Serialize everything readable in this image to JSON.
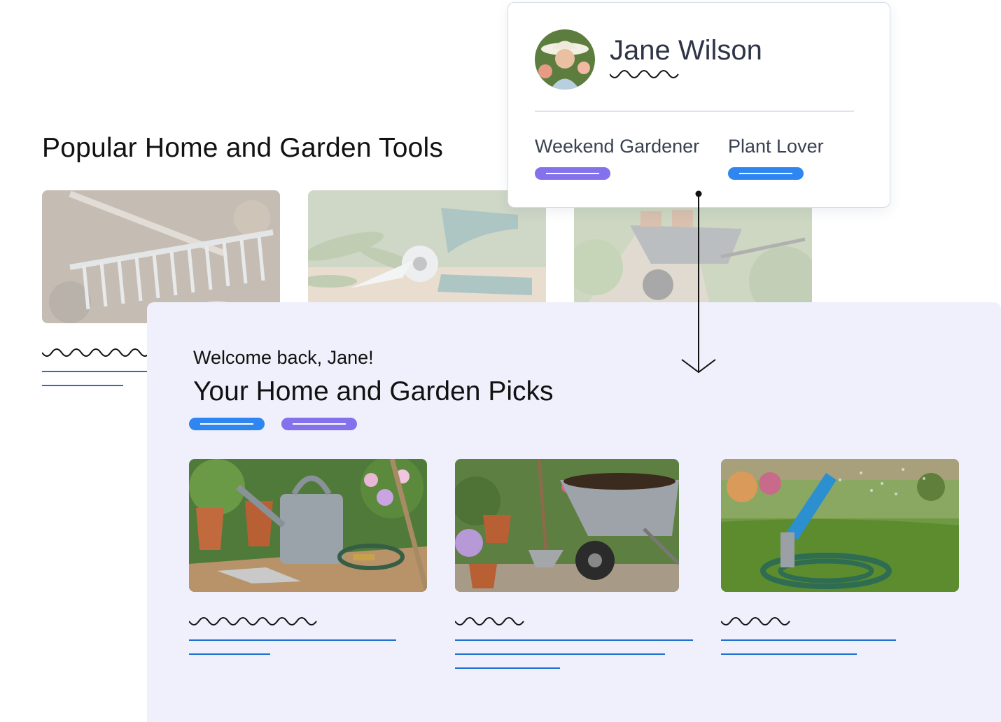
{
  "popular": {
    "title": "Popular Home and Garden Tools",
    "cards": [
      {
        "image": "garden-rake-photo"
      },
      {
        "image": "pruning-shears-photo"
      },
      {
        "image": "wheelbarrow-path-photo"
      }
    ]
  },
  "profile": {
    "name": "Jane Wilson",
    "avatar": "gardener-portrait-photo",
    "tags": [
      {
        "label": "Weekend Gardener",
        "color": "#8472ec"
      },
      {
        "label": "Plant Lover",
        "color": "#2f86f0"
      }
    ]
  },
  "picks": {
    "welcome": "Welcome back, Jane!",
    "title": "Your Home and Garden Picks",
    "pills": [
      {
        "color": "#2f86f0"
      },
      {
        "color": "#8472ec"
      }
    ],
    "cards": [
      {
        "image": "watering-can-photo"
      },
      {
        "image": "wheelbarrow-soil-photo"
      },
      {
        "image": "garden-hose-sprayer-photo"
      }
    ]
  },
  "colors": {
    "accent_blue": "#2f86f0",
    "accent_purple": "#8472ec",
    "link_line": "#1f6fd0",
    "panel_bg": "#eff0fb"
  }
}
